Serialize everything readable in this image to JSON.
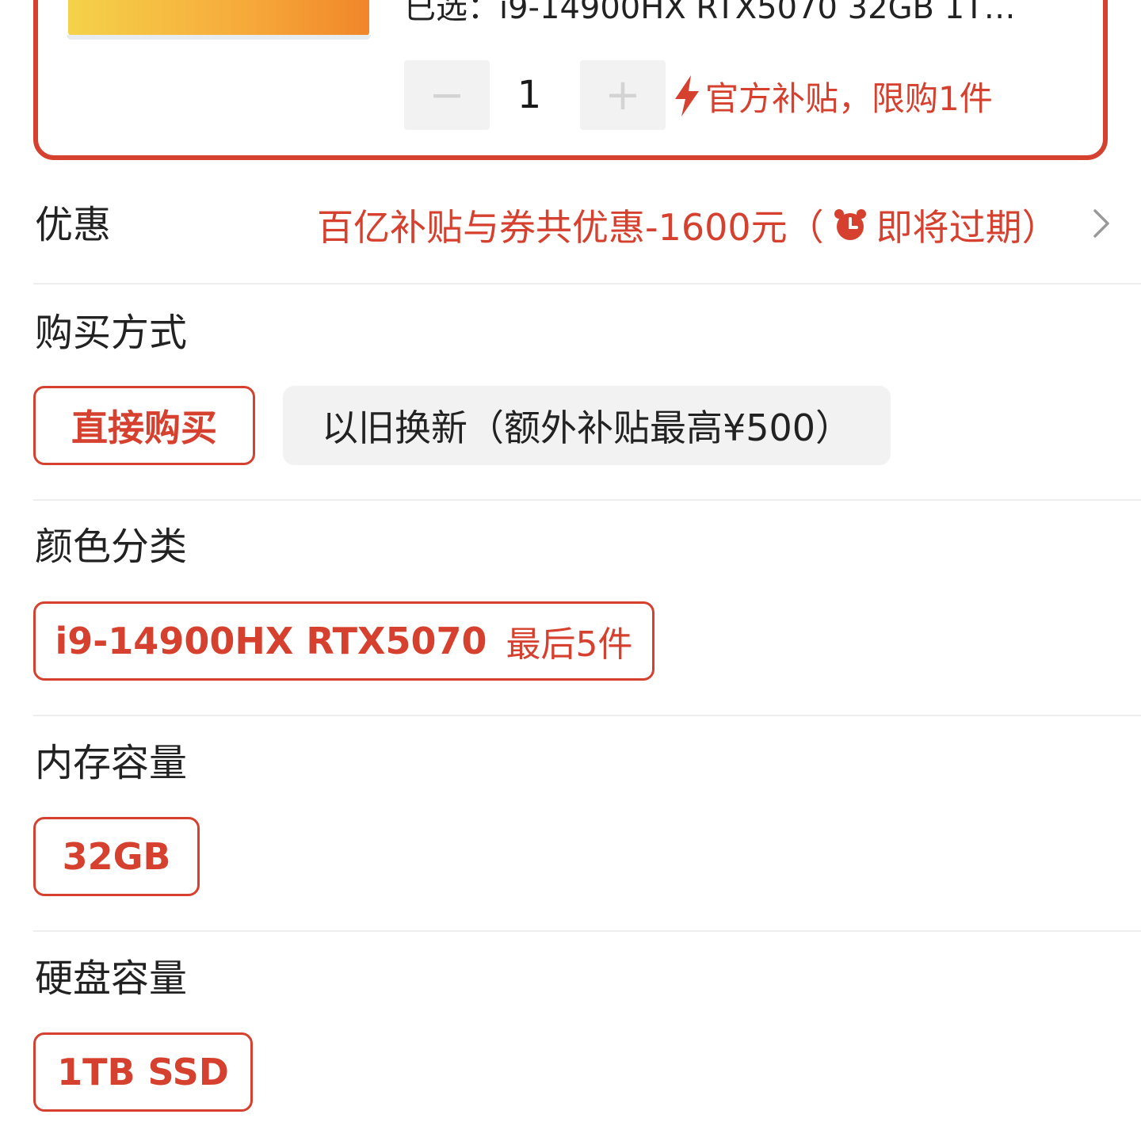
{
  "selected_product": {
    "selected_summary": "已选：i9-14900HX RTX5070 32GB 1T…",
    "quantity": "1",
    "decrement_symbol": "−",
    "increment_symbol": "+",
    "limit_notice": "官方补贴，限购1件"
  },
  "promo": {
    "label": "优惠",
    "text_before": "百亿补贴与券共优惠-1600元（",
    "text_after": "即将过期）",
    "icon": "alarm-clock-icon"
  },
  "sections": {
    "purchase_method": {
      "label": "购买方式",
      "options": [
        "直接购买",
        "以旧换新（额外补贴最高¥500）"
      ]
    },
    "color": {
      "label": "颜色分类",
      "option": "i9-14900HX RTX5070",
      "stock_tag": "最后5件"
    },
    "memory": {
      "label": "内存容量",
      "option": "32GB"
    },
    "storage": {
      "label": "硬盘容量",
      "option": "1TB SSD"
    }
  },
  "colors": {
    "accent": "#d6402e",
    "muted_bg": "#f2f2f2",
    "divider": "#eeeeee"
  }
}
